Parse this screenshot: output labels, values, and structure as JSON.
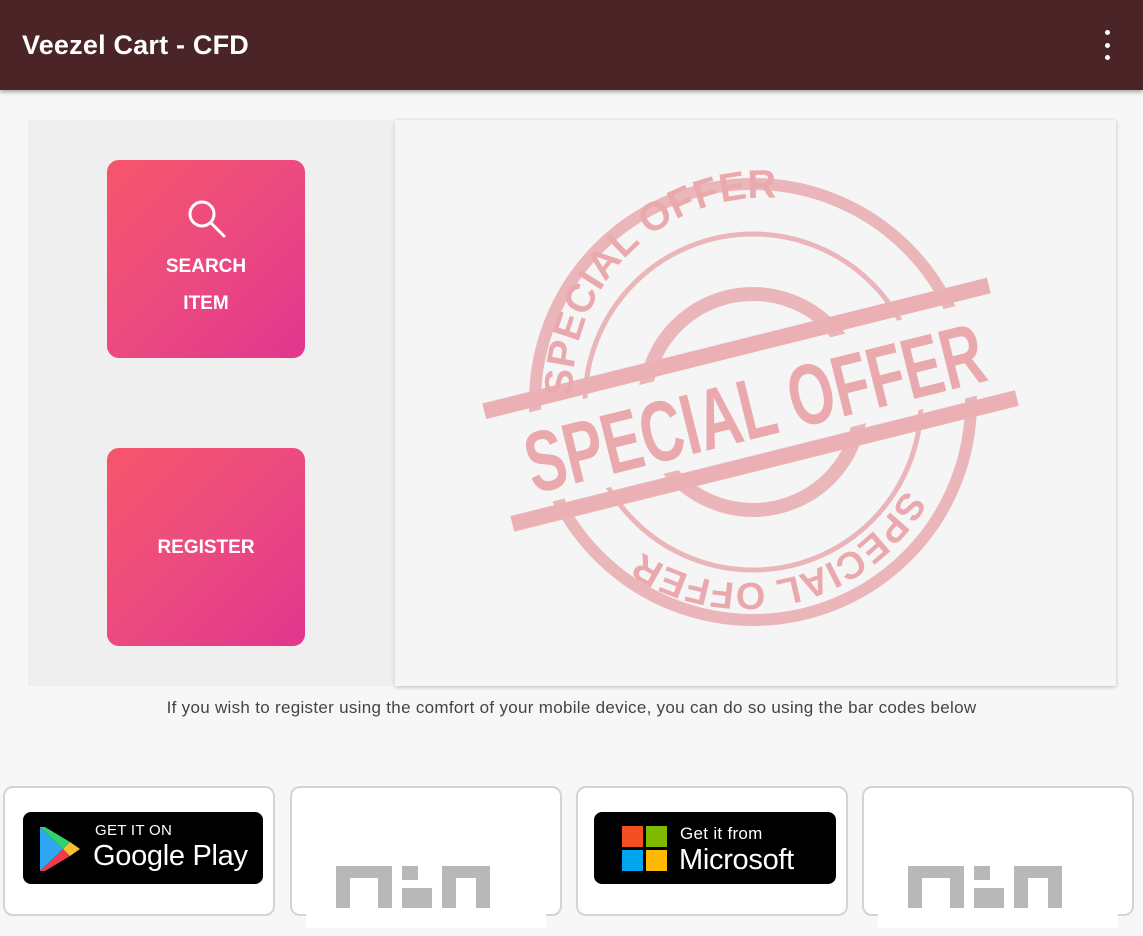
{
  "appbar": {
    "title": "Veezel Cart - CFD",
    "menu_icon": "more-vertical-icon"
  },
  "actions": {
    "search_line1": "SEARCH",
    "search_line2": "ITEM",
    "search_icon": "search-icon",
    "register": "REGISTER",
    "tile_gradient": [
      "#f5566a",
      "#e0368e"
    ]
  },
  "promo": {
    "stamp_text_big": "SPECIAL OFFER",
    "stamp_text_ring": "SPECIAL OFFER",
    "stamp_color": "#e8a9ad"
  },
  "hint_text": "If you wish to register using the comfort of your mobile device, you can do so using the bar codes below",
  "stores": {
    "google_play": {
      "small": "GET IT ON",
      "big": "Google Play"
    },
    "microsoft": {
      "small": "Get it from",
      "big": "Microsoft"
    }
  },
  "colors": {
    "appbar": "#4a2426",
    "background": "#f7f7f7",
    "accent": "#ec4a80"
  }
}
